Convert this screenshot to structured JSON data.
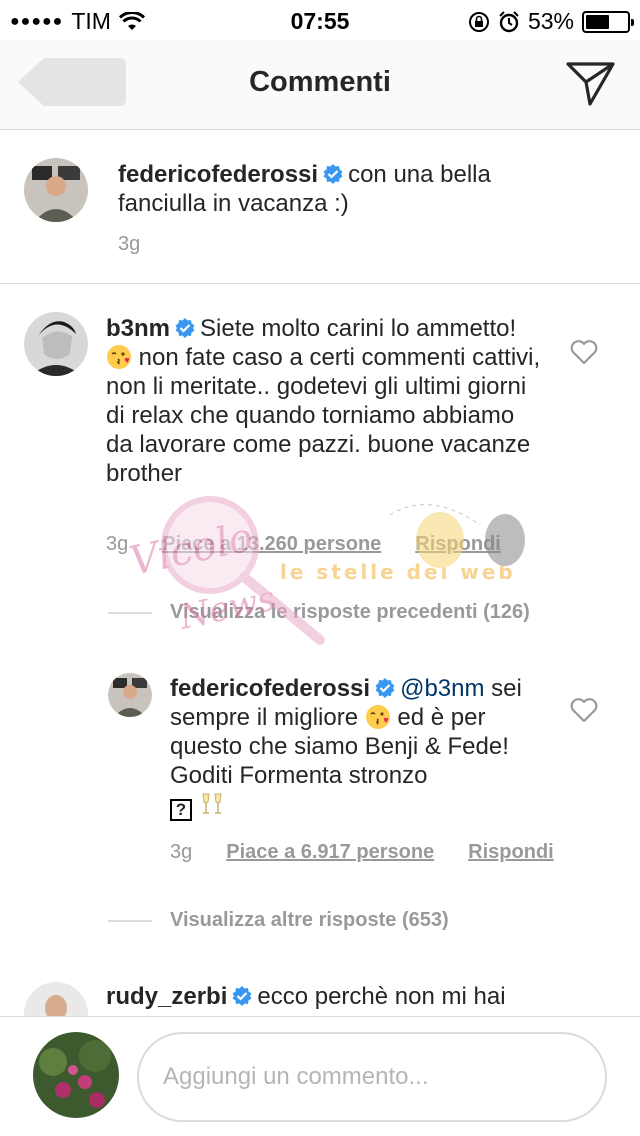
{
  "status_bar": {
    "carrier": "TIM",
    "time": "07:55",
    "battery": "53%",
    "battery_level": 0.53
  },
  "header": {
    "title": "Commenti"
  },
  "caption": {
    "username": "federicofederossi",
    "verified": true,
    "text": "con una bella fanciulla in vacanza :)",
    "time": "3g"
  },
  "comments": [
    {
      "username": "b3nm",
      "verified": true,
      "text_parts": [
        "Siete molto carini lo",
        "ammetto! ",
        " non fate caso a certi commenti cattivi, non li meritate.. godetevi gli ultimi giorni di relax che quando torniamo abbiamo da lavorare come pazzi. buone vacanze brother"
      ],
      "time": "3g",
      "likes": "Piace a 13.260 persone",
      "reply": "Rispondi",
      "view_previous": "Visualizza le risposte precedenti (126)"
    },
    {
      "username": "federicofederossi",
      "verified": true,
      "mention": "@b3nm",
      "text_parts": [
        "sei sempre il migliore ",
        " ed è per questo che siamo Benji & Fede! Goditi Formenta stronzo"
      ],
      "time": "3g",
      "likes": "Piace a 6.917 persone",
      "reply": "Rispondi",
      "view_more": "Visualizza altre risposte (653)"
    },
    {
      "username": "rudy_zerbi",
      "verified": true,
      "text": "ecco perchè non mi hai"
    }
  ],
  "composer": {
    "placeholder": "Aggiungi un commento..."
  },
  "icons": {
    "back": "back-arrow-icon",
    "send": "paper-plane-icon",
    "like": "heart-icon",
    "verified": "verified-badge-icon"
  },
  "colors": {
    "verified_blue": "#3897f0",
    "muted_text": "#999999",
    "divider": "#dbdbdb"
  },
  "watermark": {
    "brand_line_1": "Vicolo delle News",
    "brand_line_2": "le stelle del web"
  }
}
